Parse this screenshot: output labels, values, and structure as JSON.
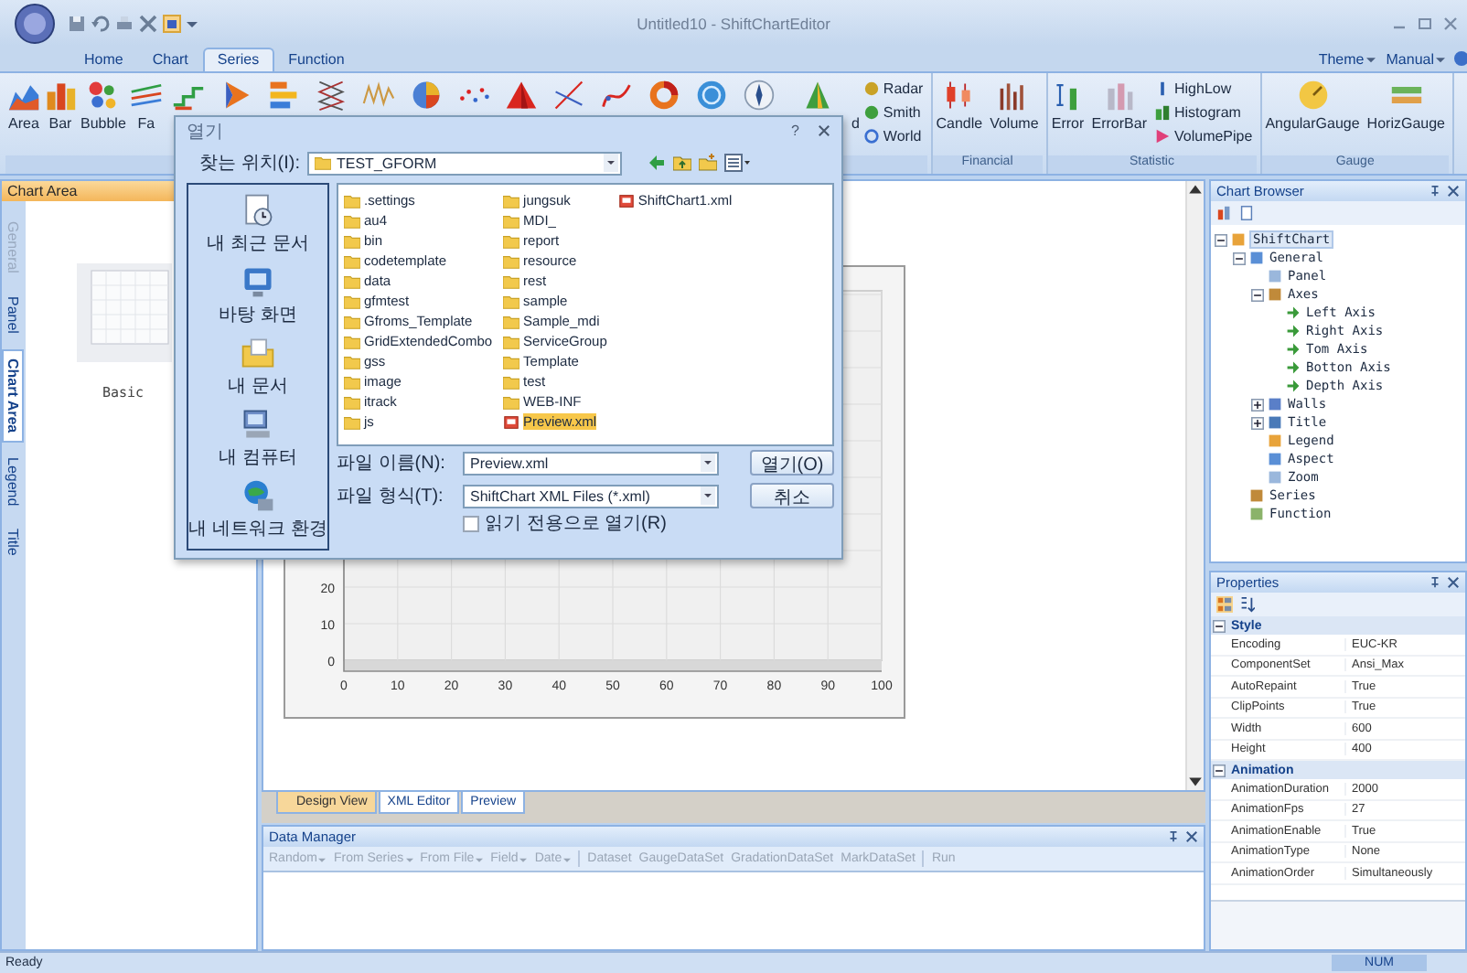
{
  "window": {
    "title": "Untitled10 - ShiftChartEditor"
  },
  "ribbon_tabs": [
    {
      "label": "Home",
      "selected": false
    },
    {
      "label": "Chart",
      "selected": false
    },
    {
      "label": "Series",
      "selected": true
    },
    {
      "label": "Function",
      "selected": false
    }
  ],
  "ribbon_menus": [
    {
      "label": "Theme"
    },
    {
      "label": "Manual"
    }
  ],
  "ribbon_groups": [
    {
      "large_buttons": [
        {
          "kind": "labeled",
          "label": "Area"
        },
        {
          "kind": "labeled",
          "label": "Bar"
        },
        {
          "kind": "labeled",
          "label": "Bubble"
        },
        {
          "kind": "labeled",
          "label": "Fa"
        },
        {
          "kind": "icon_only"
        },
        {
          "kind": "icon_only"
        },
        {
          "kind": "icon_only"
        },
        {
          "kind": "icon_only"
        },
        {
          "kind": "icon_only"
        },
        {
          "kind": "icon_only"
        },
        {
          "kind": "icon_only"
        },
        {
          "kind": "icon_only"
        },
        {
          "kind": "icon_only"
        },
        {
          "kind": "icon_only"
        },
        {
          "kind": "icon_only"
        },
        {
          "kind": "icon_only"
        },
        {
          "kind": "icon_only"
        },
        {
          "kind": "labeled",
          "label": "d"
        }
      ],
      "small_buttons": [
        {
          "label": "Radar"
        },
        {
          "label": "Smith"
        },
        {
          "label": "World"
        }
      ]
    },
    {
      "title": "Financial",
      "large_buttons": [
        {
          "kind": "labeled",
          "label": "Candle"
        },
        {
          "kind": "labeled",
          "label": "Volume"
        }
      ]
    },
    {
      "title": "Statistic",
      "large_buttons": [
        {
          "kind": "labeled",
          "label": "Error"
        },
        {
          "kind": "labeled",
          "label": "ErrorBar"
        }
      ],
      "small_buttons": [
        {
          "label": "HighLow"
        },
        {
          "label": "Histogram"
        },
        {
          "label": "VolumePipe"
        }
      ]
    },
    {
      "title": "Gauge",
      "large_buttons": [
        {
          "kind": "labeled",
          "label": "AngularGauge"
        },
        {
          "kind": "labeled",
          "label": "HorizGauge"
        }
      ]
    }
  ],
  "chart_area_pane": {
    "title": "Chart Area",
    "tabs": [
      {
        "label": "General",
        "selected": false,
        "disabled": true
      },
      {
        "label": "Panel",
        "selected": false,
        "disabled": false
      },
      {
        "label": "Chart Area",
        "selected": true,
        "disabled": false
      },
      {
        "label": "Legend",
        "selected": false,
        "disabled": false
      },
      {
        "label": "Title",
        "selected": false,
        "disabled": false
      }
    ],
    "thumbnail_label": "Basic"
  },
  "editor": {
    "y_ticks": [
      "20",
      "10",
      "0"
    ],
    "x_ticks": [
      "0",
      "10",
      "20",
      "30",
      "40",
      "50",
      "60",
      "70",
      "80",
      "90",
      "100"
    ],
    "view_tabs": [
      {
        "label": "Design View",
        "selected": true
      },
      {
        "label": "XML Editor",
        "selected": false
      },
      {
        "label": "Preview",
        "selected": false
      }
    ]
  },
  "data_manager": {
    "title": "Data Manager",
    "toolbar": [
      {
        "kind": "dropdown",
        "label": "Random",
        "disabled": true
      },
      {
        "kind": "dropdown",
        "label": "From Series",
        "disabled": true
      },
      {
        "kind": "dropdown",
        "label": "From File",
        "disabled": true
      },
      {
        "kind": "dropdown",
        "label": "Field",
        "disabled": true
      },
      {
        "kind": "dropdown",
        "label": "Date",
        "disabled": true
      },
      {
        "kind": "separator"
      },
      {
        "kind": "button",
        "label": "Dataset",
        "disabled": true
      },
      {
        "kind": "button",
        "label": "GaugeDataSet",
        "disabled": true
      },
      {
        "kind": "button",
        "label": "GradationDataSet",
        "disabled": true
      },
      {
        "kind": "button",
        "label": "MarkDataSet",
        "disabled": true
      },
      {
        "kind": "separator"
      },
      {
        "kind": "button",
        "label": "Run",
        "disabled": true
      }
    ]
  },
  "chart_browser": {
    "title": "Chart Browser",
    "tree": [
      {
        "label": "ShiftChart",
        "selected": true,
        "expanded": true,
        "children": [
          {
            "label": "General",
            "selected": false,
            "expanded": true,
            "children": [
              {
                "label": "Panel",
                "selected": false
              },
              {
                "label": "Axes",
                "selected": false,
                "expanded": true,
                "children": [
                  {
                    "label": "Left Axis",
                    "selected": false
                  },
                  {
                    "label": "Right Axis",
                    "selected": false
                  },
                  {
                    "label": "Tom Axis",
                    "selected": false
                  },
                  {
                    "label": "Botton Axis",
                    "selected": false
                  },
                  {
                    "label": "Depth Axis",
                    "selected": false
                  }
                ]
              },
              {
                "label": "Walls",
                "selected": false,
                "expanded": false
              },
              {
                "label": "Title",
                "selected": false,
                "expanded": false
              },
              {
                "label": "Legend",
                "selected": false
              },
              {
                "label": "Aspect",
                "selected": false
              },
              {
                "label": "Zoom",
                "selected": false
              }
            ]
          },
          {
            "label": "Series",
            "selected": false
          },
          {
            "label": "Function",
            "selected": false
          }
        ]
      }
    ]
  },
  "properties": {
    "title": "Properties",
    "categories": [
      {
        "name": "Style",
        "expanded": true,
        "rows": [
          {
            "name": "Encoding",
            "value": "EUC-KR"
          },
          {
            "name": "ComponentSet",
            "value": "Ansi_Max"
          },
          {
            "name": "AutoRepaint",
            "value": "True"
          },
          {
            "name": "ClipPoints",
            "value": "True"
          },
          {
            "name": "Width",
            "value": "600"
          },
          {
            "name": "Height",
            "value": "400"
          }
        ]
      },
      {
        "name": "Animation",
        "expanded": true,
        "rows": [
          {
            "name": "AnimationDuration",
            "value": "2000"
          },
          {
            "name": "AnimationFps",
            "value": "27"
          },
          {
            "name": "AnimationEnable",
            "value": "True"
          },
          {
            "name": "AnimationType",
            "value": "None"
          },
          {
            "name": "AnimationOrder",
            "value": "Simultaneously"
          }
        ]
      }
    ]
  },
  "dialog": {
    "title": "열기",
    "help_button": "?",
    "look_in_label": "찾는 위치(I):",
    "look_in": "TEST_GFORM",
    "places": [
      "내 최근 문서",
      "바탕 화면",
      "내 문서",
      "내 컴퓨터",
      "내 네트워크 환경"
    ],
    "files": [
      {
        "name": ".settings",
        "kind": "folder",
        "selected": false
      },
      {
        "name": "au4",
        "kind": "folder",
        "selected": false
      },
      {
        "name": "bin",
        "kind": "folder",
        "selected": false
      },
      {
        "name": "codetemplate",
        "kind": "folder",
        "selected": false
      },
      {
        "name": "data",
        "kind": "folder",
        "selected": false
      },
      {
        "name": "gfmtest",
        "kind": "folder",
        "selected": false
      },
      {
        "name": "Gfroms_Template",
        "kind": "folder",
        "selected": false
      },
      {
        "name": "GridExtendedCombo",
        "kind": "folder",
        "selected": false
      },
      {
        "name": "gss",
        "kind": "folder",
        "selected": false
      },
      {
        "name": "image",
        "kind": "folder",
        "selected": false
      },
      {
        "name": "itrack",
        "kind": "folder",
        "selected": false
      },
      {
        "name": "js",
        "kind": "folder",
        "selected": false
      },
      {
        "name": "jungsuk",
        "kind": "folder",
        "selected": false
      },
      {
        "name": "MDI_",
        "kind": "folder",
        "selected": false
      },
      {
        "name": "report",
        "kind": "folder",
        "selected": false
      },
      {
        "name": "resource",
        "kind": "folder",
        "selected": false
      },
      {
        "name": "rest",
        "kind": "folder",
        "selected": false
      },
      {
        "name": "sample",
        "kind": "folder",
        "selected": false
      },
      {
        "name": "Sample_mdi",
        "kind": "folder",
        "selected": false
      },
      {
        "name": "ServiceGroup",
        "kind": "folder",
        "selected": false
      },
      {
        "name": "Template",
        "kind": "folder",
        "selected": false
      },
      {
        "name": "test",
        "kind": "folder",
        "selected": false
      },
      {
        "name": "WEB-INF",
        "kind": "folder",
        "selected": false
      },
      {
        "name": "Preview.xml",
        "kind": "xml",
        "selected": true
      },
      {
        "name": "ShiftChart1.xml",
        "kind": "xml",
        "selected": false
      }
    ],
    "file_name_label": "파일 이름(N):",
    "file_name": "Preview.xml",
    "file_type_label": "파일 형식(T):",
    "file_type": "ShiftChart XML Files (*.xml)",
    "read_only": {
      "label": "읽기 전용으로 열기(R)",
      "checked": false
    },
    "buttons": [
      "열기(O)",
      "취소"
    ]
  },
  "status_bar": {
    "message": "Ready",
    "indicator": "NUM"
  }
}
